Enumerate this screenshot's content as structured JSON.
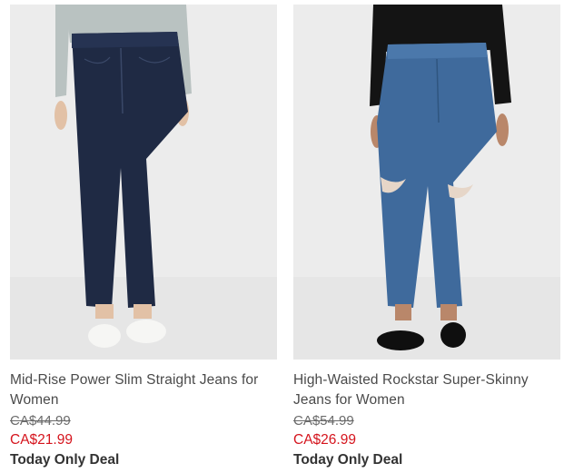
{
  "products": [
    {
      "name": "Mid-Rise Power Slim Straight Jeans for Women",
      "was_price": "CA$44.99",
      "sale_price": "CA$21.99",
      "badge": "Today Only Deal",
      "image": "dark-wash-slim-straight-jeans"
    },
    {
      "name": "High-Waisted Rockstar Super-Skinny Jeans for Women",
      "was_price": "CA$54.99",
      "sale_price": "CA$26.99",
      "badge": "Today Only Deal",
      "image": "medium-wash-ripped-skinny-jeans"
    }
  ],
  "colors": {
    "sale": "#d5141d",
    "text": "#4a4a4a",
    "dark_denim": "#1f2a44",
    "medium_denim": "#3f6a9c"
  }
}
